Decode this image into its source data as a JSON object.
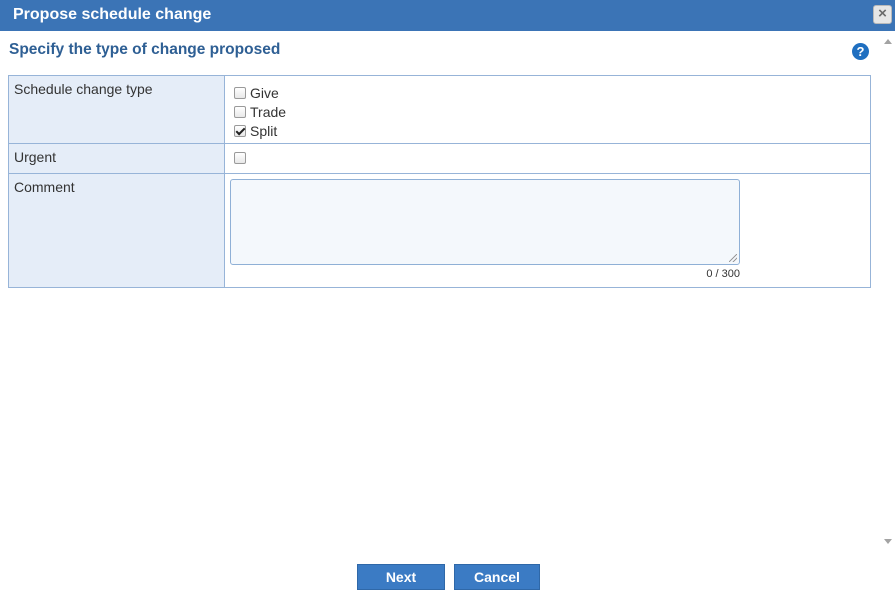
{
  "dialog": {
    "title": "Propose schedule change",
    "close_icon": "×"
  },
  "section": {
    "heading": "Specify the type of change proposed",
    "help_icon": "?"
  },
  "form": {
    "schedule_change_type": {
      "label": "Schedule change type",
      "options": [
        {
          "label": "Give",
          "checked": false
        },
        {
          "label": "Trade",
          "checked": false
        },
        {
          "label": "Split",
          "checked": true
        }
      ]
    },
    "urgent": {
      "label": "Urgent",
      "checked": false
    },
    "comment": {
      "label": "Comment",
      "value": "",
      "char_count": "0 / 300"
    }
  },
  "buttons": {
    "next": "Next",
    "cancel": "Cancel"
  },
  "colors": {
    "title_bar": "#3b74b6",
    "heading": "#2e5f94",
    "label_cell": "#e5edf8",
    "border": "#97b4d8",
    "button": "#3b7bc4"
  }
}
